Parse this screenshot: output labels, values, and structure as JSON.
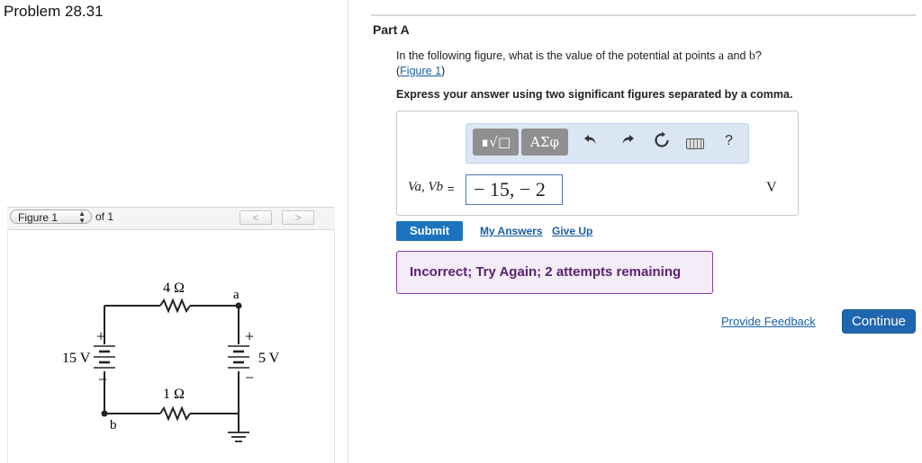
{
  "problem": {
    "title": "Problem 28.31"
  },
  "figure_nav": {
    "select_value": "Figure 1",
    "of_text": "of 1",
    "prev_label": "<",
    "next_label": ">"
  },
  "circuit": {
    "r_top": "4 Ω",
    "r_bottom": "1 Ω",
    "v_left": "15 V",
    "v_right": "5 V",
    "node_a": "a",
    "node_b": "b",
    "plus": "+",
    "minus": "−"
  },
  "part": {
    "label": "Part A",
    "question_pre": "In the following figure, what is the value of the potential at points ",
    "point_a": "a",
    "question_mid": " and ",
    "point_b": "b",
    "question_post": "?",
    "figure_link_open": "(",
    "figure_link": "Figure 1",
    "figure_link_close": ")",
    "instruction": "Express your answer using two significant figures separated by a comma."
  },
  "toolbar": {
    "templates_label": "∎√□",
    "symbols_label": "ΑΣφ",
    "undo_icon": "undo-icon",
    "redo_icon": "redo-icon",
    "reset_icon": "reset-icon",
    "keyboard_icon": "keyboard-icon",
    "help_label": "?"
  },
  "answer": {
    "variable_label": "Va, Vb",
    "equals": "=",
    "value": "− 15, − 2",
    "unit": "V"
  },
  "actions": {
    "submit": "Submit",
    "my_answers": "My Answers",
    "give_up": "Give Up"
  },
  "feedback": {
    "message": "Incorrect; Try Again; 2 attempts remaining"
  },
  "footer": {
    "provide_feedback": "Provide Feedback",
    "continue": "Continue"
  },
  "colors": {
    "link": "#1a5fa8",
    "submit_bg": "#1b73bd",
    "continue_bg": "#1f66b0",
    "feedback_border": "#8b3fa8",
    "feedback_text": "#5b2174",
    "toolbar_bg": "#dbe6f5"
  }
}
